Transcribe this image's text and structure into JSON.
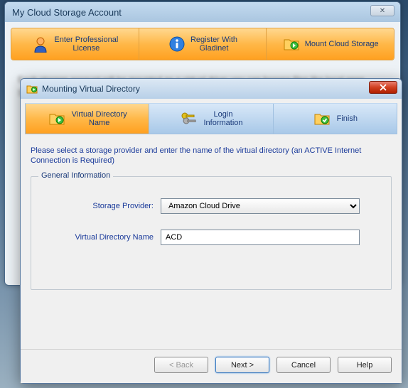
{
  "parent": {
    "title": "My Cloud Storage Account",
    "tabs": [
      {
        "label": "Enter Professional\nLicense",
        "icon": "person-icon"
      },
      {
        "label": "Register With\nGladinet",
        "icon": "info-icon"
      },
      {
        "label": "Mount Cloud Storage",
        "icon": "folder-arrow-icon"
      }
    ],
    "body_blur": "Each storage account will be mounted as a virtual drive; you can browse files like local ones. Select a provider, enter credentials, and the folder appears in explorer,"
  },
  "dialog": {
    "title": "Mounting Virtual Directory",
    "tabs": [
      {
        "label": "Virtual Directory\nName",
        "icon": "folder-arrow-icon",
        "active": true
      },
      {
        "label": "Login\nInformation",
        "icon": "keys-icon",
        "active": false
      },
      {
        "label": "Finish",
        "icon": "folder-check-icon",
        "active": false
      }
    ],
    "instruction": "Please select a storage provider and enter the name of the virtual directory (an ACTIVE Internet Connection is Required)",
    "fieldset_legend": "General Information",
    "form": {
      "provider_label": "Storage Provider:",
      "provider_value": "Amazon Cloud Drive",
      "name_label": "Virtual Directory Name",
      "name_value": "ACD"
    },
    "buttons": {
      "back": "< Back",
      "next": "Next >",
      "cancel": "Cancel",
      "help": "Help"
    }
  }
}
